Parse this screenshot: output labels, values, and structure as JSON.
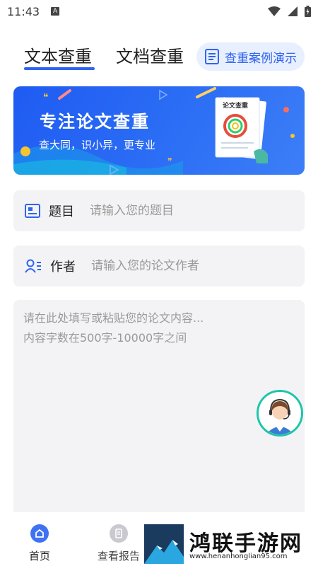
{
  "status_bar": {
    "time": "11:43",
    "notif_letter": "A"
  },
  "tabs": {
    "text_check": "文本查重",
    "doc_check": "文档查重",
    "demo_button": "查重案例演示"
  },
  "banner": {
    "title": "专注论文查重",
    "subtitle": "查大同，识小异，更专业",
    "paper_label": "论文查重"
  },
  "form": {
    "title_label": "题目",
    "title_placeholder": "请输入您的题目",
    "author_label": "作者",
    "author_placeholder": "请输入您的论文作者",
    "content_placeholder": "请在此处填写或粘贴您的论文内容...\n内容字数在500字-10000字之间"
  },
  "bottom_nav": {
    "home": "首页",
    "report": "查看报告"
  },
  "watermark": {
    "text": "鸿联手游网",
    "url": "www.henanhonglian95.com"
  },
  "colors": {
    "accent": "#2f64f0",
    "banner": "#1f5bf2",
    "field_bg": "#f3f3f5",
    "support_ring": "#1cc6a8"
  },
  "icons": [
    "wifi-icon",
    "signal-icon",
    "battery-icon",
    "list-icon",
    "id-card-icon",
    "user-list-icon",
    "customer-service-icon",
    "home-icon",
    "report-icon"
  ]
}
